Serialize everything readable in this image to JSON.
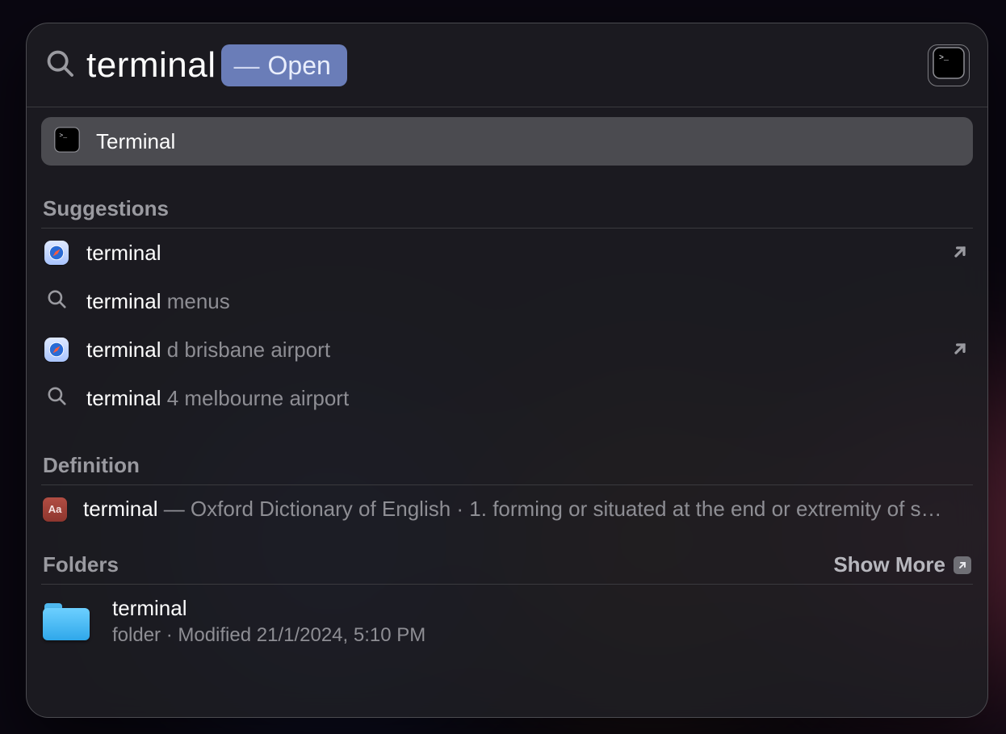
{
  "search": {
    "query": "terminal",
    "action_label": "Open"
  },
  "top_hit": {
    "label": "Terminal"
  },
  "sections": {
    "suggestions_header": "Suggestions",
    "definition_header": "Definition",
    "folders_header": "Folders",
    "show_more_label": "Show More"
  },
  "suggestions": [
    {
      "icon": "safari",
      "bold": "terminal",
      "rest": "",
      "jump": true
    },
    {
      "icon": "search",
      "bold": "terminal",
      "rest": " menus",
      "jump": false
    },
    {
      "icon": "safari",
      "bold": "terminal",
      "rest": " d brisbane airport",
      "jump": true
    },
    {
      "icon": "search",
      "bold": "terminal",
      "rest": " 4 melbourne airport",
      "jump": false
    }
  ],
  "definition": {
    "bold": "terminal",
    "rest": " — Oxford Dictionary of English · 1. forming or situated at the end or extremity of s…",
    "dict_badge": "Aa"
  },
  "folders": [
    {
      "name": "terminal",
      "meta": "folder · Modified 21/1/2024, 5:10 PM"
    }
  ]
}
